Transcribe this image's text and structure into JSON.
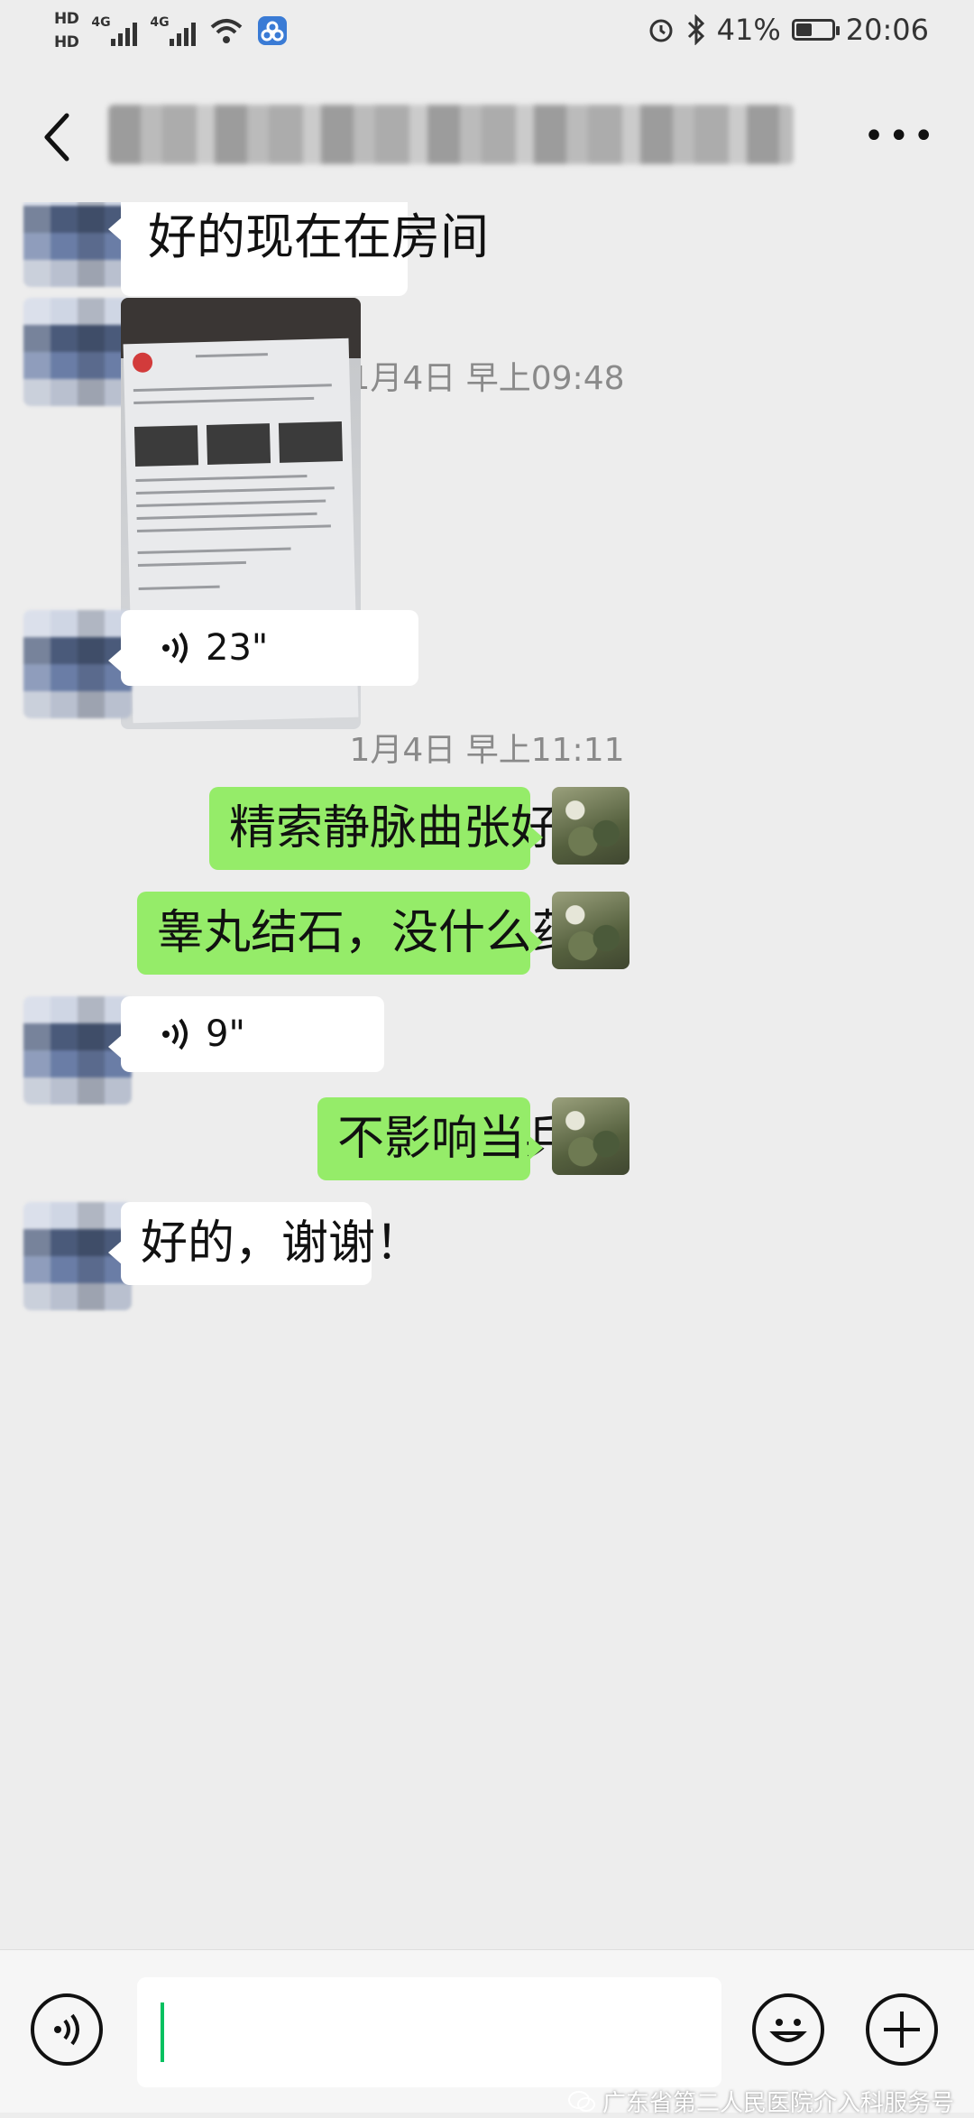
{
  "status_bar": {
    "hd1": "HD",
    "hd2": "HD",
    "sim1_network": "4G",
    "sim2_network": "4G",
    "battery_text": "41%",
    "clock": "20:06"
  },
  "nav": {
    "back_icon": "chevron-left-icon",
    "more_icon": "more-icon"
  },
  "messages": [
    {
      "side": "in",
      "type": "text",
      "text": "好的现在在房间"
    },
    {
      "side": "time",
      "text": "1月4日 早上09:48"
    },
    {
      "side": "in",
      "type": "image"
    },
    {
      "side": "in",
      "type": "voice",
      "duration": "23\""
    },
    {
      "side": "time",
      "text": "1月4日 早上11:11"
    },
    {
      "side": "out",
      "type": "text",
      "text": "精索静脉曲张好了"
    },
    {
      "side": "out",
      "type": "text",
      "text": "睾丸结石，没什么药的"
    },
    {
      "side": "in",
      "type": "voice",
      "duration": "9\""
    },
    {
      "side": "out",
      "type": "text",
      "text": "不影响当兵"
    },
    {
      "side": "in",
      "type": "text",
      "text": "好的，谢谢！"
    }
  ],
  "input_bar": {
    "voice_icon": "voice-input-icon",
    "emoji_icon": "emoji-icon",
    "plus_icon": "plus-icon"
  },
  "watermark": "广东省第二人民医院介入科服务号",
  "colors": {
    "background": "#ededed",
    "out_bubble": "#95ec69",
    "in_bubble": "#ffffff",
    "caret": "#07c160"
  }
}
